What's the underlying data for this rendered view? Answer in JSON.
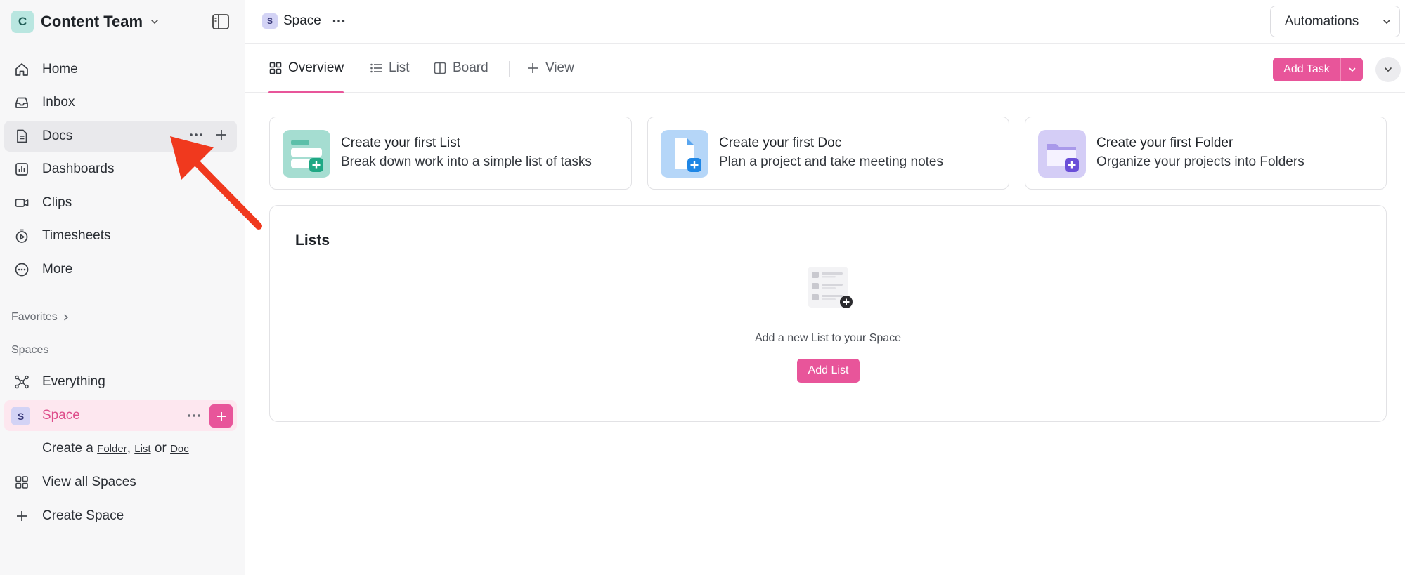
{
  "workspace": {
    "initial": "C",
    "name": "Content Team"
  },
  "sidebar": {
    "nav": [
      {
        "label": "Home",
        "icon": "home-icon"
      },
      {
        "label": "Inbox",
        "icon": "inbox-icon"
      },
      {
        "label": "Docs",
        "icon": "doc-icon",
        "active": true
      },
      {
        "label": "Dashboards",
        "icon": "dashboard-icon"
      },
      {
        "label": "Clips",
        "icon": "video-icon"
      },
      {
        "label": "Timesheets",
        "icon": "timer-icon"
      },
      {
        "label": "More",
        "icon": "more-icon"
      }
    ],
    "favorites_label": "Favorites",
    "spaces_label": "Spaces",
    "everything_label": "Everything",
    "space": {
      "initial": "S",
      "label": "Space"
    },
    "create_prefix": "Create a",
    "create_folder": "Folder",
    "create_comma": ",",
    "create_list": "List",
    "create_or": "or",
    "create_doc": "Doc",
    "view_all_spaces": "View all Spaces",
    "create_space": "Create Space"
  },
  "topbar": {
    "breadcrumb_initial": "S",
    "breadcrumb_label": "Space",
    "automations_label": "Automations"
  },
  "tabs": [
    {
      "label": "Overview",
      "icon": "grid-icon",
      "active": true
    },
    {
      "label": "List",
      "icon": "list-icon"
    },
    {
      "label": "Board",
      "icon": "board-icon"
    },
    {
      "label": "View",
      "icon": "plus-icon"
    }
  ],
  "add_task_label": "Add Task",
  "cards": [
    {
      "title": "Create your first List",
      "subtitle": "Break down work into a simple list of tasks"
    },
    {
      "title": "Create your first Doc",
      "subtitle": "Plan a project and take meeting notes"
    },
    {
      "title": "Create your first Folder",
      "subtitle": "Organize your projects into Folders"
    }
  ],
  "lists_panel": {
    "title": "Lists",
    "empty_text": "Add a new List to your Space",
    "add_list_label": "Add List"
  },
  "colors": {
    "accent": "#e8559a",
    "space_highlight": "#fde7ef",
    "annotation_arrow": "#f0391e"
  }
}
